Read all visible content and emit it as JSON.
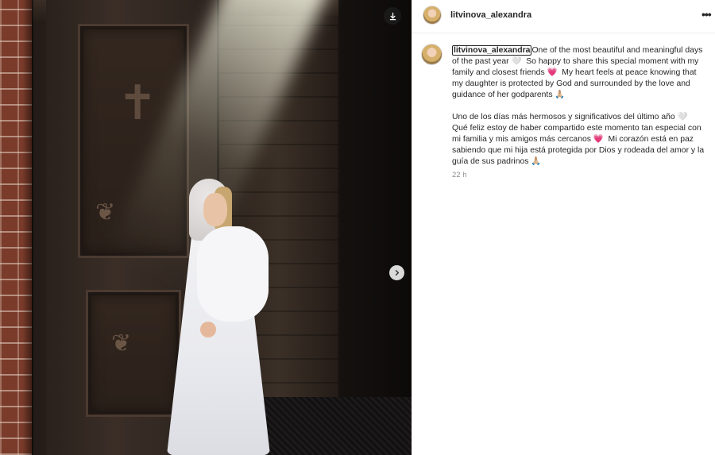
{
  "post": {
    "username": "litvinova_alexandra",
    "caption_en": "One of the most beautiful and meaningful days of the past year 🤍  So happy to share this special moment with my family and closest friends 💗  My heart feels at peace knowing that my daughter is protected by God and surrounded by the love and guidance of her godparents 🙏🏼",
    "caption_es": "Uno de los días más hermosos y significativos del último año 🤍 Qué feliz estoy de haber compartido este momento tan especial con mi familia y mis amigos más cercanos 💗  Mi corazón está en paz sabiendo que mi hija está protegida por Dios y rodeada del amor y la guía de sus padrinos 🙏🏼",
    "timestamp": "22 h"
  },
  "icons": {
    "download": "download-icon",
    "next": "chevron-right-icon",
    "more": "more-options-icon"
  },
  "colors": {
    "text": "#262626",
    "muted": "#8e8e8e",
    "border": "#efefef"
  }
}
